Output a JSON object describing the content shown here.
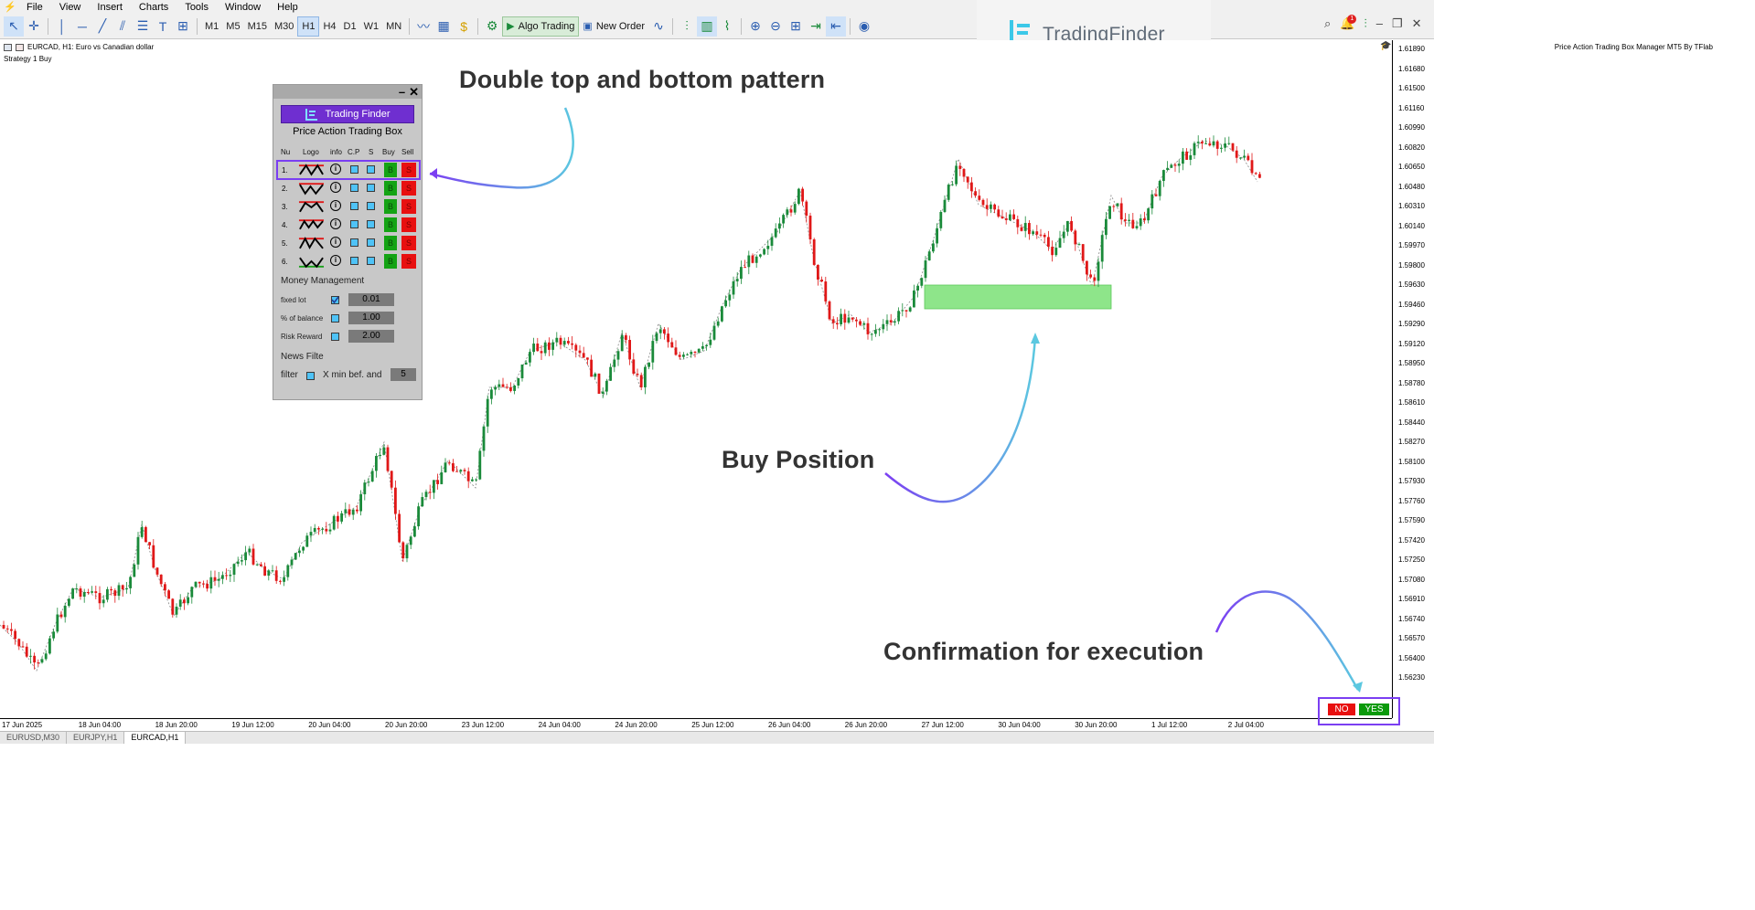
{
  "menubar": {
    "items": [
      "File",
      "View",
      "Insert",
      "Charts",
      "Tools",
      "Window",
      "Help"
    ]
  },
  "toolbar": {
    "timeframes": [
      "M1",
      "M5",
      "M15",
      "M30",
      "H1",
      "H4",
      "D1",
      "W1",
      "MN"
    ],
    "active_timeframe": "H1",
    "algo_trading": "Algo Trading",
    "new_order": "New Order"
  },
  "brand": {
    "name": "TradingFinder"
  },
  "chart": {
    "symbol_line": "EURCAD, H1:  Euro vs Canadian dollar",
    "strategy_line": "Strategy 1 Buy",
    "ea_label": "Price Action Trading Box Manager MT5 By TFlab",
    "price_ticks": [
      "1.61890",
      "1.61680",
      "1.61500",
      "1.61160",
      "1.60990",
      "1.60820",
      "1.60650",
      "1.60480",
      "1.60310",
      "1.60140",
      "1.59970",
      "1.59800",
      "1.59630",
      "1.59460",
      "1.59290",
      "1.59120",
      "1.58950",
      "1.58780",
      "1.58610",
      "1.58440",
      "1.58270",
      "1.58100",
      "1.57930",
      "1.57760",
      "1.57590",
      "1.57420",
      "1.57250",
      "1.57080",
      "1.56910",
      "1.56740",
      "1.56570",
      "1.56400",
      "1.56230"
    ],
    "time_ticks": [
      "17 Jun 2025",
      "18 Jun 04:00",
      "18 Jun 20:00",
      "19 Jun 12:00",
      "20 Jun 04:00",
      "20 Jun 20:00",
      "23 Jun 12:00",
      "24 Jun 04:00",
      "24 Jun 20:00",
      "25 Jun 12:00",
      "26 Jun 04:00",
      "26 Jun 20:00",
      "27 Jun 12:00",
      "30 Jun 04:00",
      "30 Jun 20:00",
      "1 Jul 12:00",
      "2 Jul 04:00"
    ],
    "colors": {
      "bull": "#1a8a3a",
      "bear": "#e01818",
      "zone": "#8ee58a",
      "accent": "#7b3ff2",
      "arrow": "#5bc8e0"
    }
  },
  "tabs": [
    "EURUSD,M30",
    "EURJPY,H1",
    "EURCAD,H1"
  ],
  "active_tab": "EURCAD,H1",
  "panel": {
    "logo_text": "Trading Finder",
    "title": "Price Action Trading Box",
    "headers": [
      "Nu",
      "Logo",
      "info",
      "C.P",
      "S",
      "Buy",
      "Sell"
    ],
    "rows": [
      {
        "num": "1.",
        "info": "i",
        "buy": "B",
        "sell": "S"
      },
      {
        "num": "2.",
        "info": "i",
        "buy": "B",
        "sell": "S"
      },
      {
        "num": "3.",
        "info": "i",
        "buy": "B",
        "sell": "S"
      },
      {
        "num": "4.",
        "info": "i",
        "buy": "B",
        "sell": "S"
      },
      {
        "num": "5.",
        "info": "i",
        "buy": "B",
        "sell": "S"
      },
      {
        "num": "6.",
        "info": "i",
        "buy": "B",
        "sell": "S"
      }
    ],
    "money_management": "Money Management",
    "fixed_lot_label": "fixed lot",
    "fixed_lot_value": "0.01",
    "balance_label": "% of balance",
    "balance_value": "1.00",
    "rr_label": "Risk Reward",
    "rr_value": "2.00",
    "news_filter": "News Filte",
    "filter_label": "filter",
    "filter_desc": "X min bef. and",
    "filter_value": "5"
  },
  "annotations": {
    "pattern": "Double top and bottom pattern",
    "buy": "Buy Position",
    "confirm": "Confirmation for execution"
  },
  "confirm": {
    "no": "NO",
    "yes": "YES"
  }
}
